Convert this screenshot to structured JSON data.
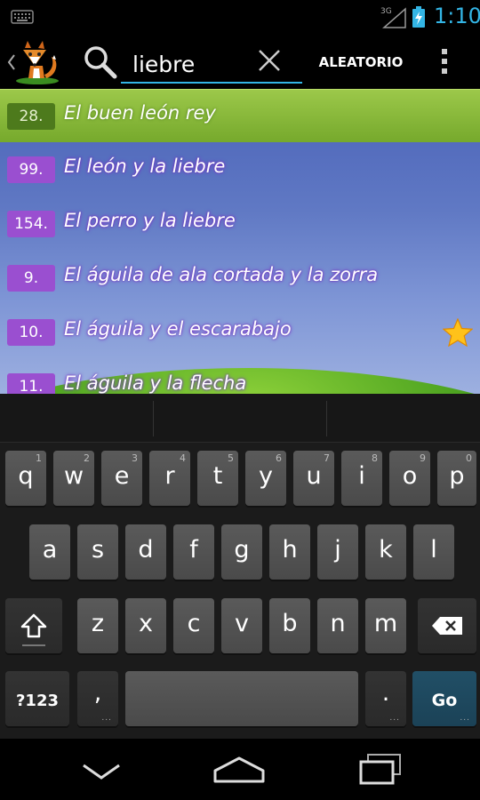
{
  "status_bar": {
    "time": "1:10",
    "network": "3G"
  },
  "action_bar": {
    "search_value": "liebre",
    "random_label": "ALEATORIO"
  },
  "results": [
    {
      "number": "28.",
      "title": "El buen león rey",
      "selected": true,
      "favorite": false
    },
    {
      "number": "99.",
      "title": "El león y la liebre",
      "selected": false,
      "favorite": false
    },
    {
      "number": "154.",
      "title": "El perro y la liebre",
      "selected": false,
      "favorite": false
    },
    {
      "number": "9.",
      "title": "El águila de ala cortada y la zorra",
      "selected": false,
      "favorite": false
    },
    {
      "number": "10.",
      "title": "El águila y el escarabajo",
      "selected": false,
      "favorite": true
    },
    {
      "number": "11.",
      "title": "El águila y la flecha",
      "selected": false,
      "favorite": false
    }
  ],
  "keyboard": {
    "row1": [
      {
        "label": "q",
        "hint": "1"
      },
      {
        "label": "w",
        "hint": "2"
      },
      {
        "label": "e",
        "hint": "3"
      },
      {
        "label": "r",
        "hint": "4"
      },
      {
        "label": "t",
        "hint": "5"
      },
      {
        "label": "y",
        "hint": "6"
      },
      {
        "label": "u",
        "hint": "7"
      },
      {
        "label": "i",
        "hint": "8"
      },
      {
        "label": "o",
        "hint": "9"
      },
      {
        "label": "p",
        "hint": "0"
      }
    ],
    "row2": [
      "a",
      "s",
      "d",
      "f",
      "g",
      "h",
      "j",
      "k",
      "l"
    ],
    "row3": [
      "z",
      "x",
      "c",
      "v",
      "b",
      "n",
      "m"
    ],
    "symbols_label": "?123",
    "comma_label": ",",
    "period_label": ".",
    "go_label": "Go"
  },
  "colors": {
    "accent": "#33b5e5",
    "selected_row": "#8dbb3c",
    "number_badge": "#9a4fd0",
    "go_key": "#1f4a60"
  }
}
